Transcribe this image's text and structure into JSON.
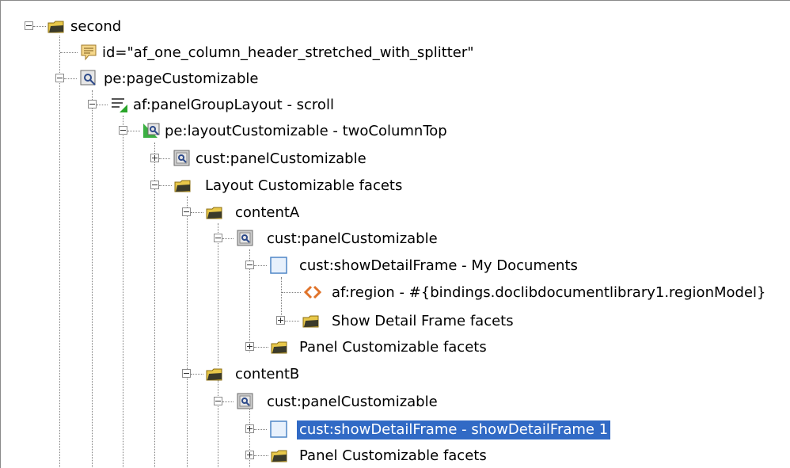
{
  "tree": {
    "nodes": [
      {
        "label": "second",
        "icon": "folder-icon"
      },
      {
        "label": "id=\"af_one_column_header_stretched_with_splitter\"",
        "icon": "comment-icon"
      },
      {
        "label": "pe:pageCustomizable",
        "icon": "customizable-component-icon"
      },
      {
        "label": "af:panelGroupLayout - scroll",
        "icon": "panel-layout-icon"
      },
      {
        "label": "pe:layoutCustomizable - twoColumnTop",
        "icon": "layout-customizable-icon"
      },
      {
        "label": "cust:panelCustomizable",
        "icon": "customizable-component-icon"
      },
      {
        "label": "Layout Customizable facets",
        "icon": "folder-icon"
      },
      {
        "label": "contentA",
        "icon": "folder-icon"
      },
      {
        "label": "cust:panelCustomizable",
        "icon": "customizable-component-icon"
      },
      {
        "label": "cust:showDetailFrame - My Documents",
        "icon": "frame-icon"
      },
      {
        "label": "af:region - #{bindings.doclibdocumentlibrary1.regionModel}",
        "icon": "region-icon"
      },
      {
        "label": "Show Detail Frame facets",
        "icon": "folder-icon"
      },
      {
        "label": "Panel Customizable facets",
        "icon": "folder-icon"
      },
      {
        "label": "contentB",
        "icon": "folder-icon"
      },
      {
        "label": "cust:panelCustomizable",
        "icon": "customizable-component-icon"
      },
      {
        "label": "cust:showDetailFrame - showDetailFrame 1",
        "icon": "frame-icon"
      },
      {
        "label": "Panel Customizable facets",
        "icon": "folder-icon"
      }
    ]
  },
  "colors": {
    "selection": "#316ac5",
    "folder": "#e8c84a",
    "connector": "#7d7d7d"
  }
}
